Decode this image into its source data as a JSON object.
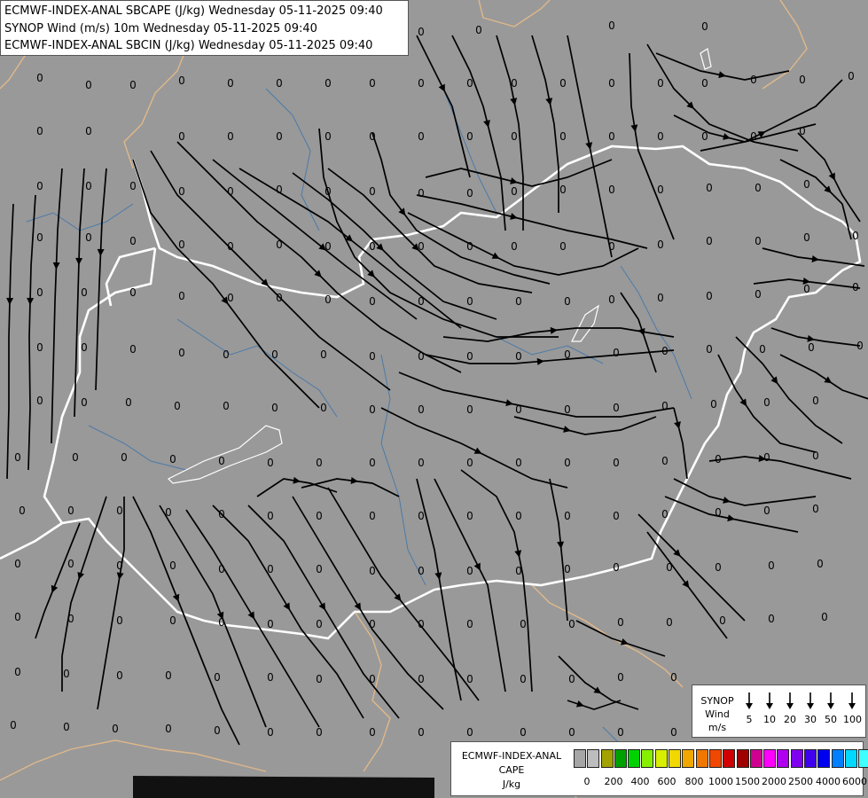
{
  "header": {
    "line1": "ECMWF-INDEX-ANAL SBCAPE (J/kg) Wednesday 05-11-2025 09:40",
    "line2": "SYNOP Wind (m/s) 10m Wednesday 05-11-2025 09:40",
    "line3": "ECMWF-INDEX-ANAL SBCIN (J/kg) Wednesday 05-11-2025 09:40"
  },
  "value_label": "0",
  "wind_legend": {
    "title_lines": [
      "SYNOP",
      "Wind",
      "m/s"
    ],
    "speeds": [
      "5",
      "10",
      "20",
      "30",
      "50",
      "100"
    ]
  },
  "cape_legend": {
    "title_lines": [
      "ECMWF-INDEX-ANAL",
      "CAPE",
      "J/kg"
    ],
    "colors": [
      "#a6a6a6",
      "#bdbdbd",
      "#a2a200",
      "#00a000",
      "#00d200",
      "#86f000",
      "#d8f000",
      "#f0d800",
      "#f0a800",
      "#f07800",
      "#f04800",
      "#d00000",
      "#a00000",
      "#d00090",
      "#ff00ff",
      "#b000f0",
      "#8000f0",
      "#4000f0",
      "#0000f0",
      "#0080ff",
      "#00d8ff",
      "#40ffff",
      "#ffffff"
    ],
    "tick_labels": [
      "0",
      "200",
      "400",
      "600",
      "800",
      "1000",
      "1500",
      "2000",
      "2500",
      "4000",
      "6000"
    ]
  },
  "colors": {
    "background": "#999999",
    "country_border": "#ffffff",
    "region_border": "#e0b88a",
    "river": "#4b7aa8",
    "streamline": "#000000"
  }
}
